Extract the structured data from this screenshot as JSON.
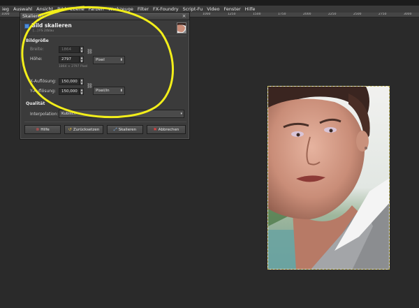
{
  "menubar": {
    "items": [
      "ieg",
      "Auswahl",
      "Ansicht",
      "Bild",
      "Ebene",
      "Farben",
      "Werkzeuge",
      "Filter",
      "FX-Foundry",
      "Script-Fu",
      "Video",
      "Fenster",
      "Hilfe"
    ]
  },
  "ruler": {
    "ticks": [
      "1000",
      "1000",
      "500",
      "250",
      "0",
      "250",
      "500",
      "750",
      "1000",
      "1250",
      "1500",
      "1750",
      "2000",
      "2250",
      "2500",
      "2750",
      "3000"
    ]
  },
  "dialog": {
    "window_title": "Skalieren",
    "close_glyph": "×",
    "header_title": "Bild skalieren",
    "header_sub": "[...] FS 2/blau",
    "section_size": "Bildgröße",
    "width_label": "Breite:",
    "width_value": "1864",
    "height_label": "Höhe:",
    "height_value": "2797",
    "unit_value": "Pixel",
    "size_hint": "1864 × 2797 Pixel",
    "xres_label": "X-Auflösung:",
    "xres_value": "150,000",
    "yres_label": "Y-Auflösung:",
    "yres_value": "150,000",
    "res_unit_value": "Pixel/in",
    "section_quality": "Qualität",
    "interp_label": "Interpolation:",
    "interp_value": "Kubisch",
    "buttons": {
      "help": "Hilfe",
      "reset": "Zurücksetzen",
      "scale": "Skalieren",
      "cancel": "Abbrechen"
    }
  },
  "colors": {
    "annotation": "#f2ee1a",
    "selection": "#c9c16a"
  }
}
